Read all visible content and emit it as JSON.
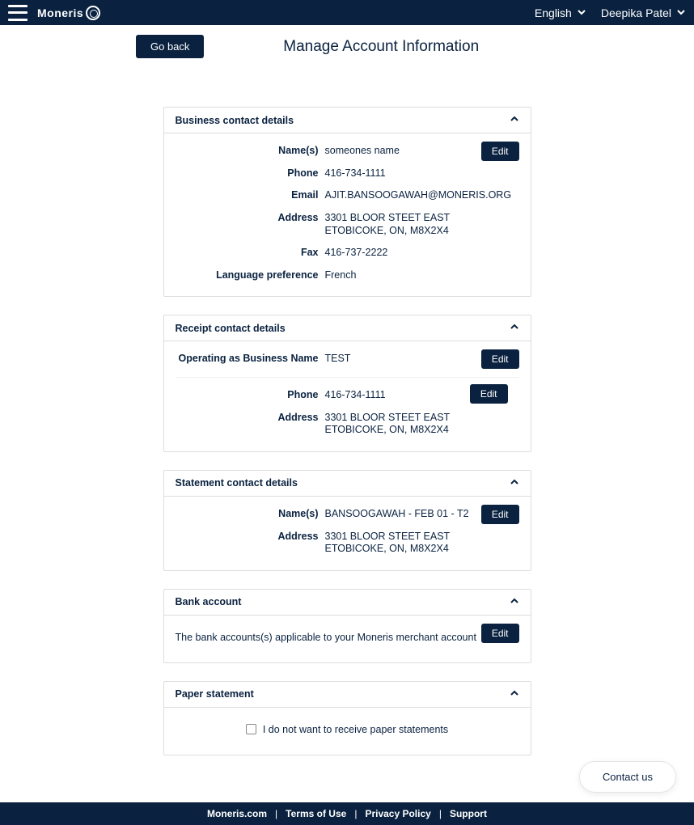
{
  "header": {
    "brand": "Moneris",
    "language": "English",
    "user": "Deepika Patel"
  },
  "page": {
    "go_back": "Go back",
    "title": "Manage Account Information"
  },
  "cards": {
    "business": {
      "title": "Business contact details",
      "edit": "Edit",
      "name_label": "Name(s)",
      "name": "someones name",
      "phone_label": "Phone",
      "phone": "416-734-1111",
      "email_label": "Email",
      "email": "AJIT.BANSOOGAWAH@MONERIS.ORG",
      "address_label": "Address",
      "address_line1": "3301 BLOOR STEET EAST",
      "address_line2": "ETOBICOKE, ON, M8X2X4",
      "fax_label": "Fax",
      "fax": "416-737-2222",
      "lang_label": "Language preference",
      "lang": "French"
    },
    "receipt": {
      "title": "Receipt contact details",
      "edit": "Edit",
      "oba_label": "Operating as Business Name",
      "oba": "TEST",
      "phone_label": "Phone",
      "phone": "416-734-1111",
      "address_label": "Address",
      "address_line1": "3301 BLOOR STEET EAST",
      "address_line2": "ETOBICOKE, ON, M8X2X4"
    },
    "statement": {
      "title": "Statement contact details",
      "edit": "Edit",
      "name_label": "Name(s)",
      "name": "BANSOOGAWAH - FEB 01 - T2",
      "address_label": "Address",
      "address_line1": "3301 BLOOR STEET EAST",
      "address_line2": "ETOBICOKE, ON, M8X2X4"
    },
    "bank": {
      "title": "Bank account",
      "edit": "Edit",
      "text": "The bank accounts(s) applicable to your Moneris merchant account"
    },
    "paper": {
      "title": "Paper statement",
      "text": "I do not want to receive paper statements"
    }
  },
  "contact_us": "Contact us",
  "footer": {
    "moneris": "Moneris.com",
    "terms": "Terms of Use",
    "privacy": "Privacy Policy",
    "support": "Support"
  }
}
